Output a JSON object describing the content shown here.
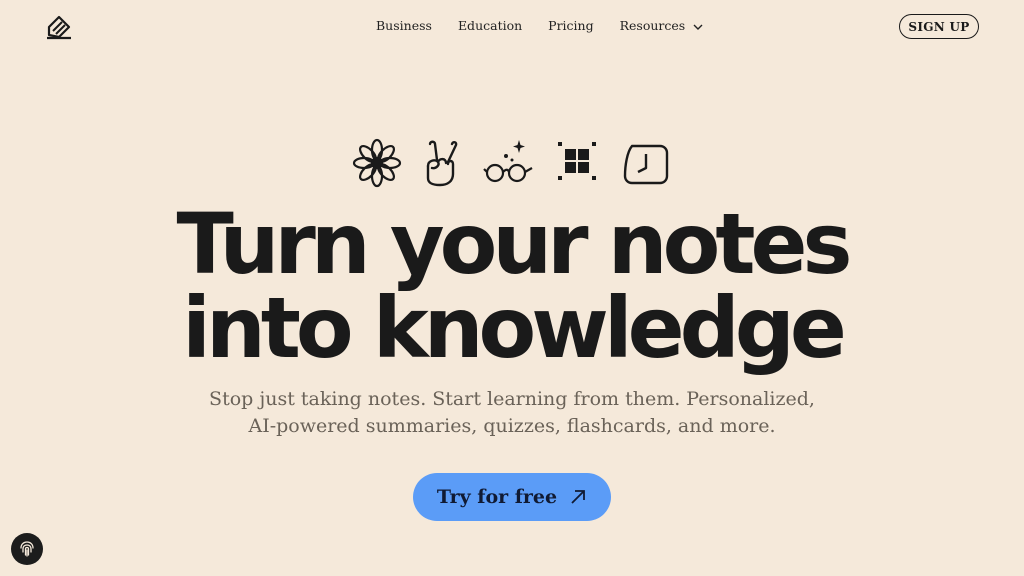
{
  "nav": {
    "logo_icon": "pencil-square-icon",
    "links": [
      {
        "label": "Business"
      },
      {
        "label": "Education"
      },
      {
        "label": "Pricing"
      },
      {
        "label": "Resources",
        "icon": "chevron-down-icon"
      }
    ],
    "signup_label": "SIGN UP"
  },
  "hero": {
    "icons": [
      "flower-icon",
      "peace-hand-icon",
      "glasses-sparkle-icon",
      "grid-focus-icon",
      "clock-icon"
    ],
    "headline_line1": "Turn your notes",
    "headline_line2": "into knowledge",
    "subtitle_line1": "Stop just taking notes. Start learning from them. Personalized,",
    "subtitle_line2": "AI-powered summaries, quizzes, flashcards, and more.",
    "cta_label": "Try for free",
    "cta_icon": "arrow-up-right-icon",
    "cta_color": "#5b9cf7"
  },
  "floating": {
    "icon": "fingerprint-icon"
  },
  "colors": {
    "background": "#f5e9da",
    "text": "#1a1a1a",
    "subtitle": "#6a6258"
  }
}
